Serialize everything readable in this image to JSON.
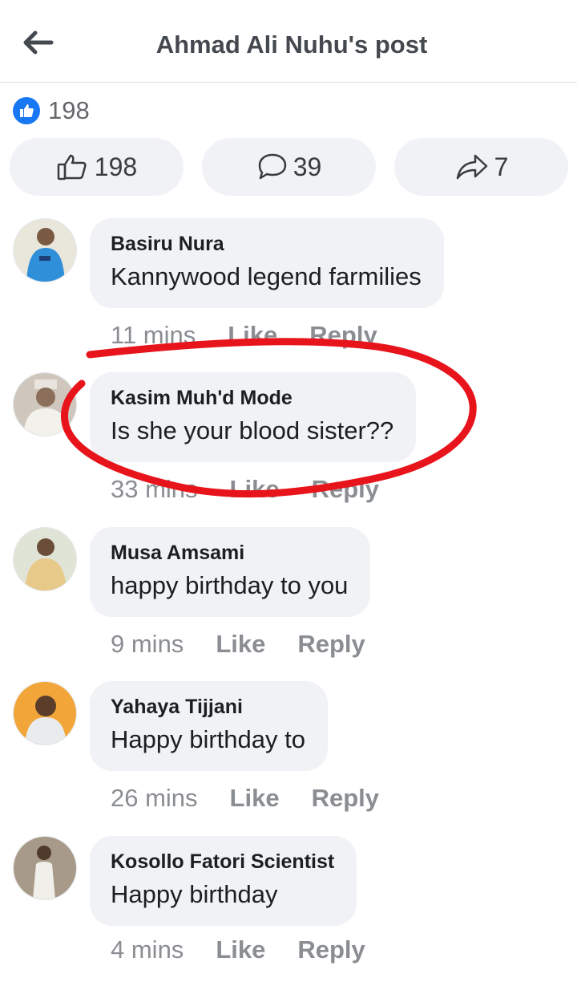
{
  "header": {
    "title": "Ahmad Ali Nuhu's post",
    "back_icon": "arrow-left-icon"
  },
  "summary": {
    "reaction_icon": "like-thumb-icon",
    "count": "198"
  },
  "actions": [
    {
      "icon": "thumbs-up-outline-icon",
      "count": "198"
    },
    {
      "icon": "comment-bubble-icon",
      "count": "39"
    },
    {
      "icon": "share-arrow-icon",
      "count": "7"
    }
  ],
  "comments": [
    {
      "name": "Basiru Nura",
      "text": "Kannywood legend farmilies",
      "time": "11 mins",
      "like": "Like",
      "reply": "Reply",
      "avatar_color": "#2f8fd8"
    },
    {
      "name": "Kasim Muh'd Mode",
      "text": "Is she your blood sister??",
      "time": "33 mins",
      "like": "Like",
      "reply": "Reply",
      "avatar_color": "#8b6f5a"
    },
    {
      "name": "Musa Amsami",
      "text": "happy birthday to you",
      "time": "9 mins",
      "like": "Like",
      "reply": "Reply",
      "avatar_color": "#b8b9a2"
    },
    {
      "name": "Yahaya Tijjani",
      "text": "Happy birthday to",
      "time": "26 mins",
      "like": "Like",
      "reply": "Reply",
      "avatar_color": "#f2a63a"
    },
    {
      "name": "Kosollo Fatori Scientist",
      "text": "Happy birthday",
      "time": "4 mins",
      "like": "Like",
      "reply": "Reply",
      "avatar_color": "#6e5b4a"
    }
  ],
  "annotation": {
    "color": "#e8141b",
    "shape": "hand-drawn-circle",
    "target": "comment-2"
  }
}
